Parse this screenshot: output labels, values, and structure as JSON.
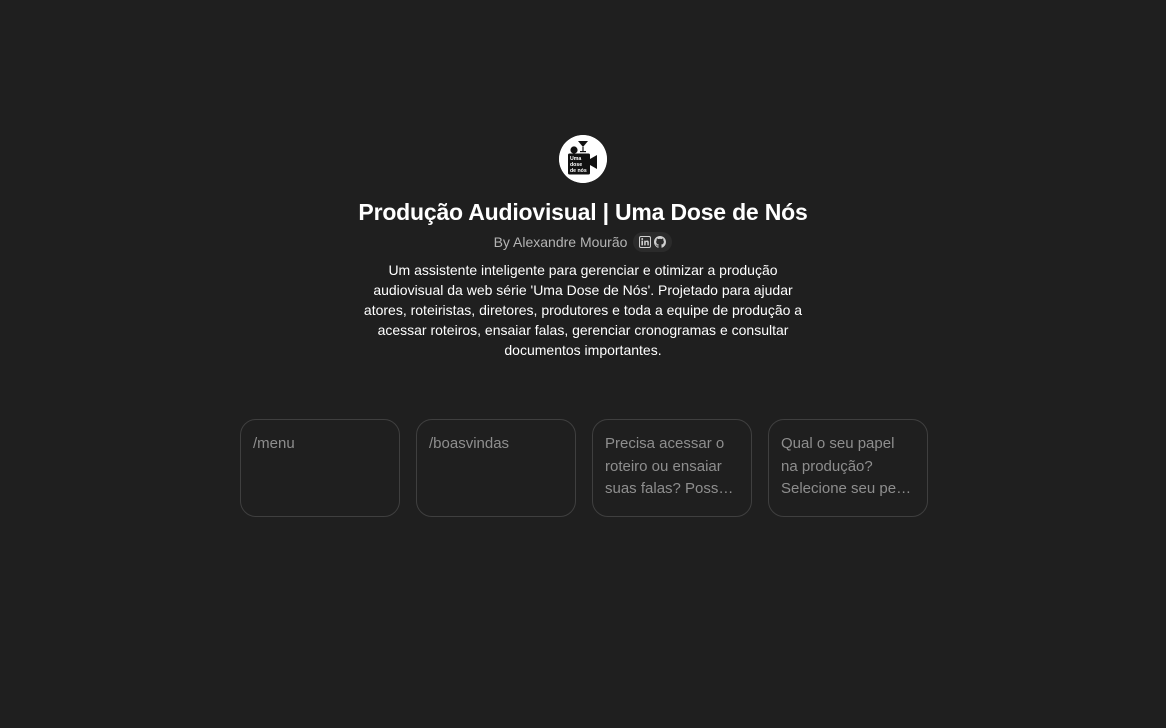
{
  "gpt": {
    "logo": {
      "icon": "uma-dose-de-nos-logo",
      "lines": [
        "Uma",
        "dose",
        "de nós"
      ]
    },
    "title": "Produção Audiovisual | Uma Dose de Nós",
    "author": "By Alexandre Mourão",
    "social_links": [
      {
        "icon": "linkedin-icon"
      },
      {
        "icon": "github-icon"
      }
    ],
    "description": "Um assistente inteligente para gerenciar e otimizar a produção audiovisual da web série 'Uma Dose de Nós'. Projetado para ajudar atores, roteiristas, diretores, produtores e toda a equipe de produção a acessar roteiros, ensaiar falas, gerenciar cronogramas e consultar documentos importantes."
  },
  "conversation_starters": [
    {
      "text": "/menu"
    },
    {
      "text": "/boasvindas"
    },
    {
      "text": "Precisa acessar o roteiro ou ensaiar suas falas? Posso ajudar com isso!"
    },
    {
      "text": "Qual o seu papel na produção? Selecione seu perfil para começar."
    }
  ],
  "colors": {
    "background": "#1f1f1f",
    "title": "#ffffff",
    "muted_text": "#b4b4b4",
    "card_border": "#3f3f3f",
    "card_text": "#8e8e8e"
  }
}
